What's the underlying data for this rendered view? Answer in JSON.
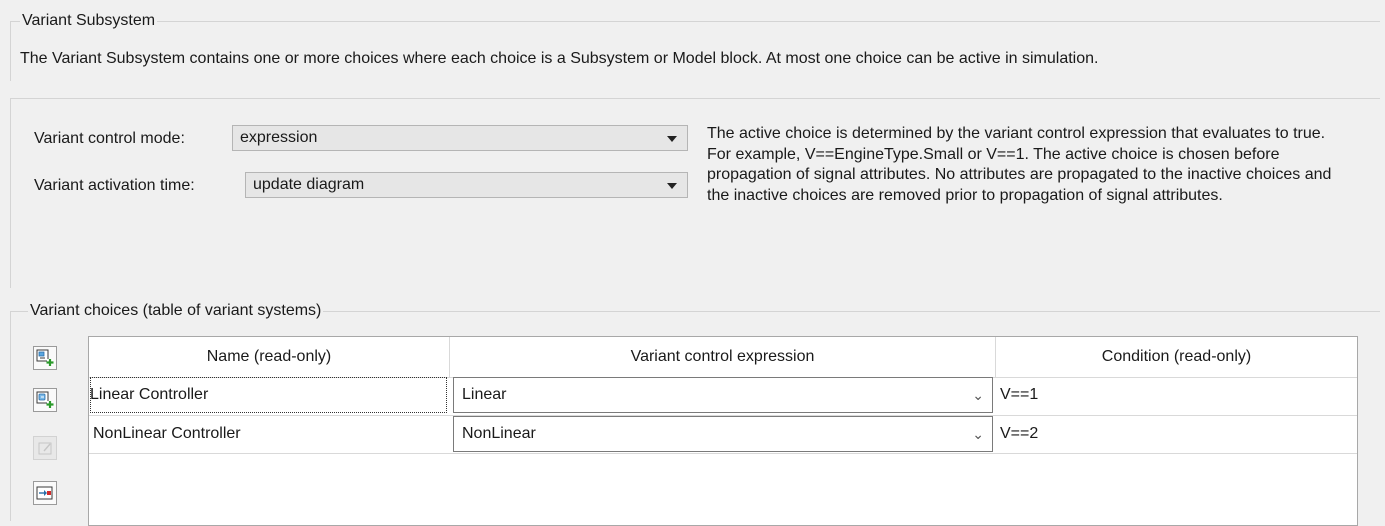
{
  "subsystem_group": {
    "title": "Variant Subsystem",
    "description": "The Variant Subsystem contains one or more choices where each choice is a Subsystem or Model block. At most one choice can be active in simulation."
  },
  "params": {
    "control_mode_label": "Variant control mode:",
    "control_mode_value": "expression",
    "activation_time_label": "Variant activation time:",
    "activation_time_value": "update diagram",
    "help_text": "The active choice is determined by the variant control expression that evaluates to true. For example, V==EngineType.Small or V==1. The active choice is chosen before propagation of signal attributes. No attributes are propagated to the inactive choices and the inactive choices are removed prior to propagation of signal attributes."
  },
  "choices": {
    "title": "Variant choices (table of variant systems)",
    "columns": [
      "Name (read-only)",
      "Variant control expression",
      "Condition (read-only)"
    ],
    "rows": [
      {
        "name": "Linear Controller",
        "expression": "Linear",
        "condition": "V==1"
      },
      {
        "name": "NonLinear Controller",
        "expression": "NonLinear",
        "condition": "V==2"
      }
    ],
    "buttons": [
      {
        "icon": "add-subsystem-choice-icon",
        "enabled": true
      },
      {
        "icon": "add-model-choice-icon",
        "enabled": true
      },
      {
        "icon": "edit-choice-icon",
        "enabled": false
      },
      {
        "icon": "open-block-icon",
        "enabled": true
      }
    ]
  }
}
